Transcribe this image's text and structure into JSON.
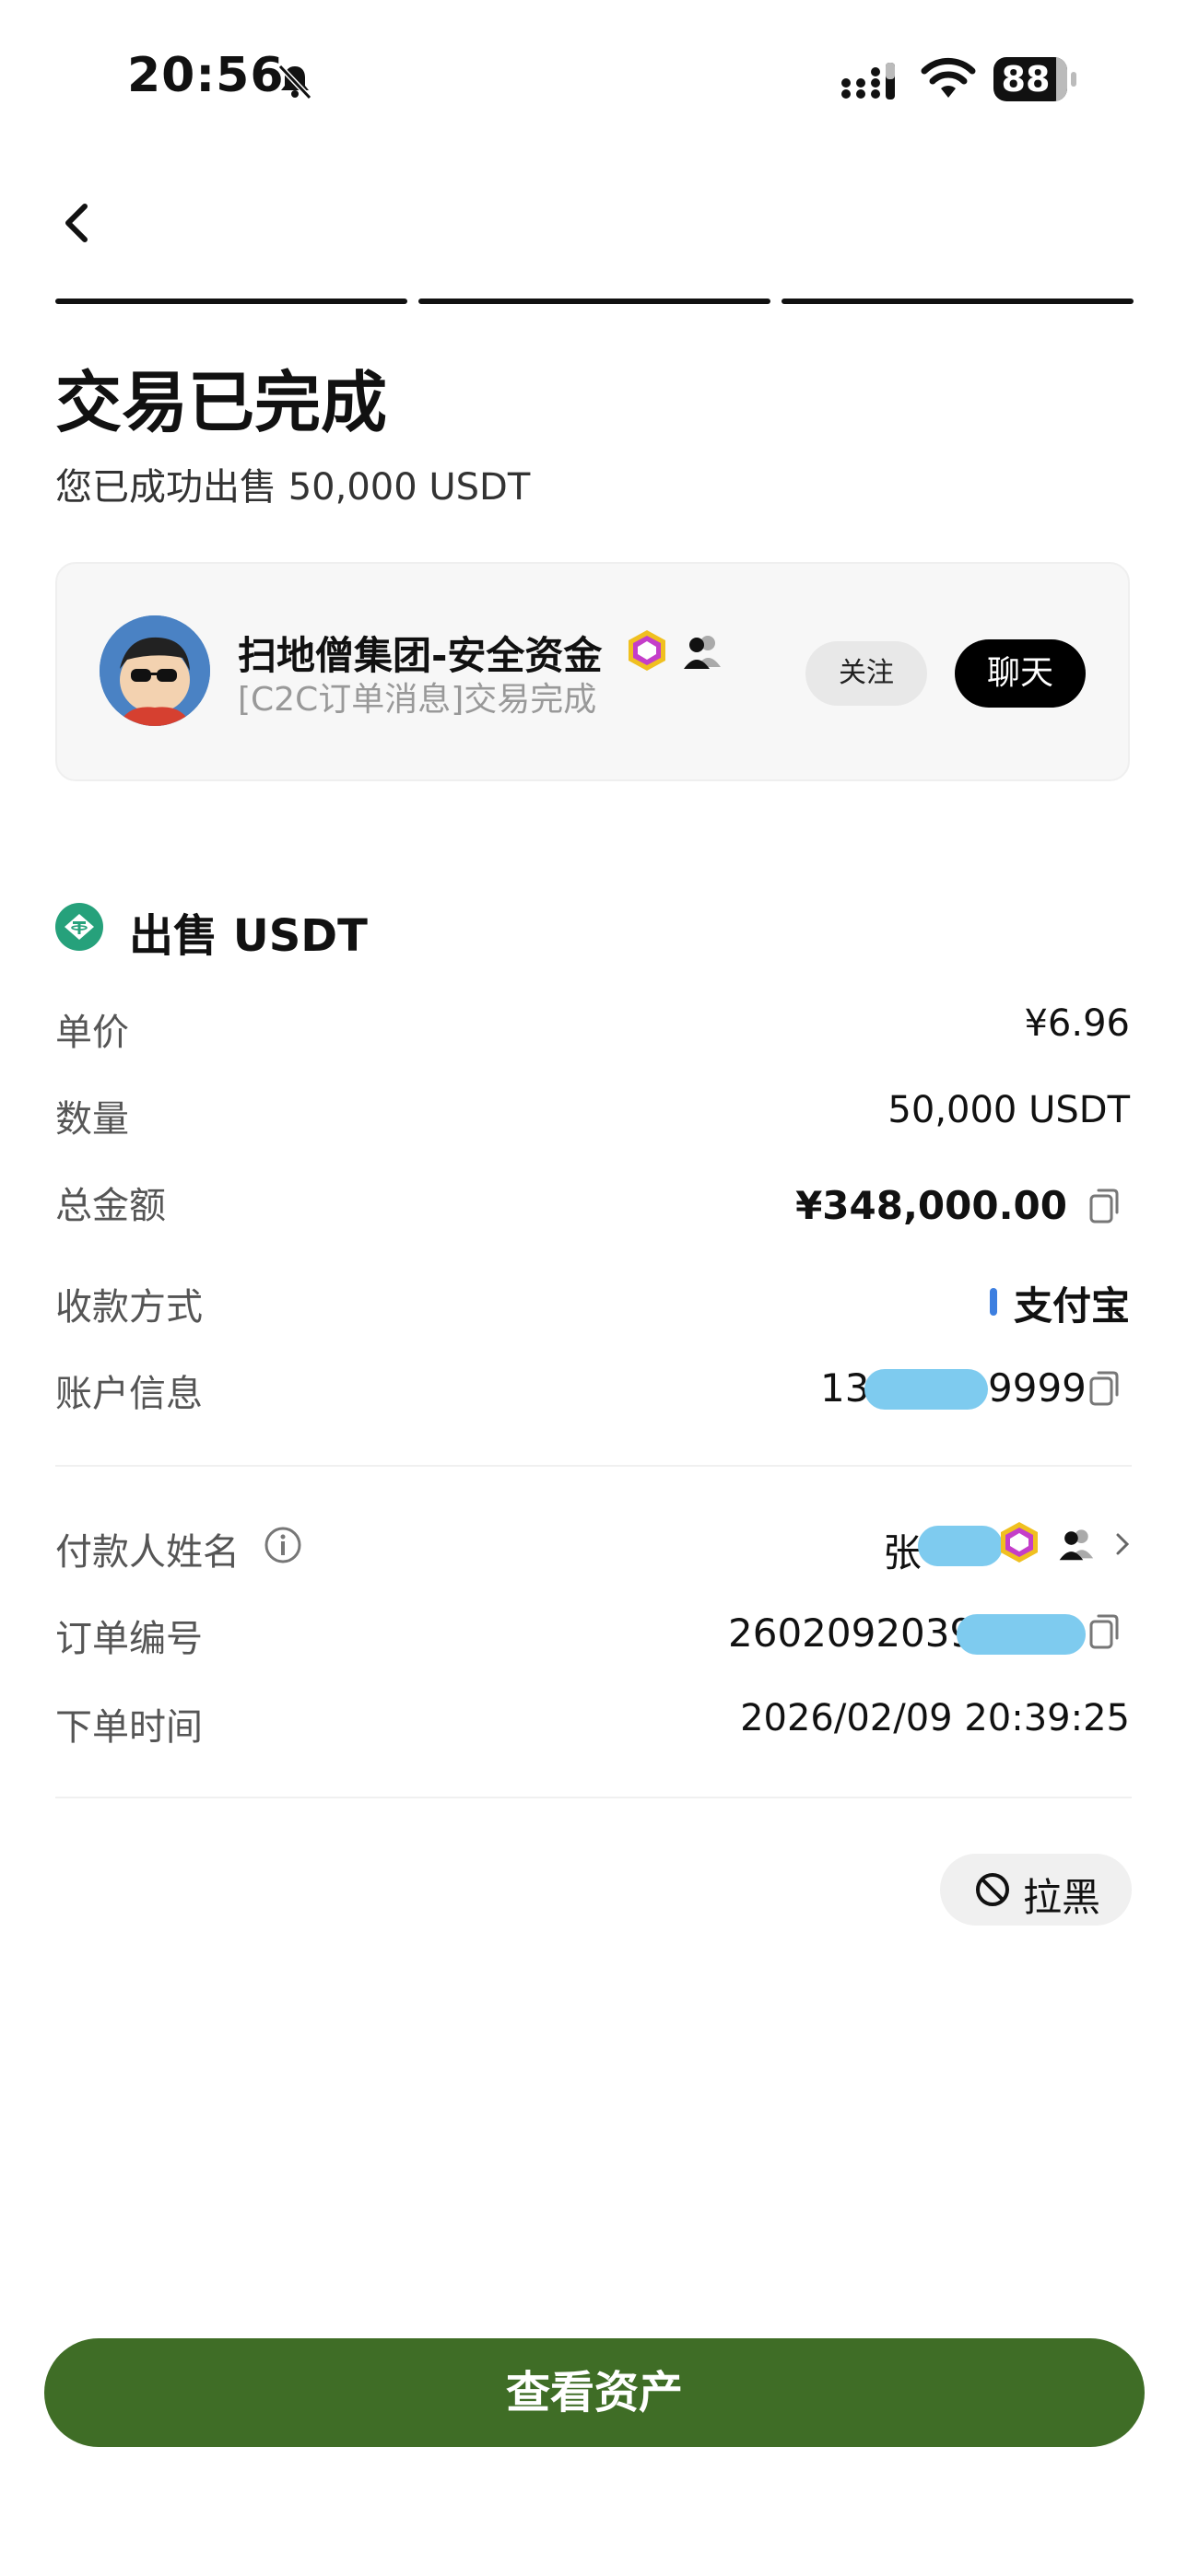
{
  "status_bar": {
    "time": "20:56",
    "battery": "88"
  },
  "header": {
    "title": "交易已完成",
    "subtitle": "您已成功出售 50,000 USDT"
  },
  "counterparty": {
    "name": "扫地僧集团-安全资金",
    "message": "[C2C订单消息]交易完成",
    "follow_label": "关注",
    "chat_label": "聊天"
  },
  "order": {
    "section_title": "出售 USDT",
    "rows": [
      {
        "label": "单价",
        "value": "¥6.96"
      },
      {
        "label": "数量",
        "value": "50,000 USDT"
      },
      {
        "label": "总金额",
        "value": "¥348,000.00"
      },
      {
        "label": "收款方式",
        "value": "支付宝"
      },
      {
        "label": "账户信息",
        "value_prefix": "13",
        "value_suffix": "9999"
      }
    ],
    "rows2": [
      {
        "label": "付款人姓名",
        "value_prefix": "张"
      },
      {
        "label": "订单编号",
        "value_prefix": "2602092039"
      },
      {
        "label": "下单时间",
        "value": "2026/02/09 20:39:25"
      }
    ]
  },
  "block_label": "拉黑",
  "cta_label": "查看资产"
}
